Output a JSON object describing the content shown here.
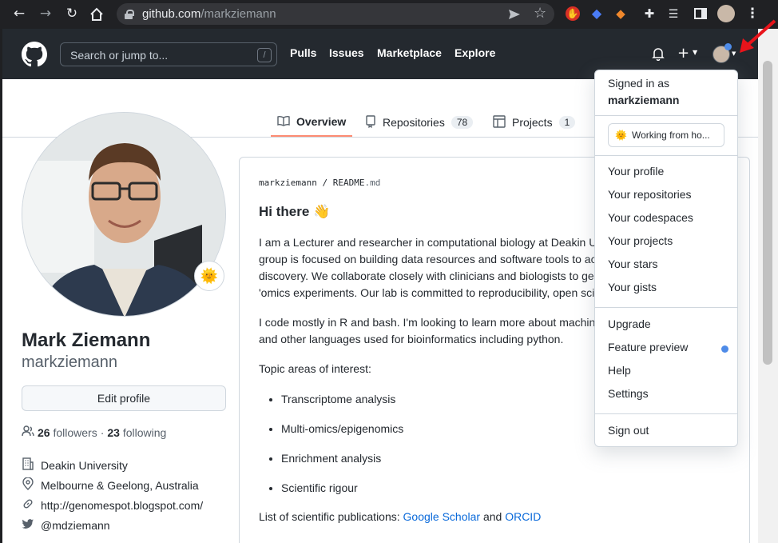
{
  "browser": {
    "url_host": "github.com",
    "url_path": "/markziemann"
  },
  "header": {
    "search_placeholder": "Search or jump to...",
    "search_shortcut": "/",
    "nav": [
      "Pulls",
      "Issues",
      "Marketplace",
      "Explore"
    ]
  },
  "tabs": [
    {
      "label": "Overview",
      "count": null
    },
    {
      "label": "Repositories",
      "count": "78"
    },
    {
      "label": "Projects",
      "count": "1"
    }
  ],
  "profile": {
    "name": "Mark Ziemann",
    "login": "markziemann",
    "edit_label": "Edit profile",
    "followers_count": "26",
    "followers_label": "followers",
    "separator": "·",
    "following_count": "23",
    "following_label": "following",
    "company": "Deakin University",
    "location": "Melbourne & Geelong, Australia",
    "website": "http://genomespot.blogspot.com/",
    "twitter": "@mdziemann",
    "status_emoji": "🌞"
  },
  "readme": {
    "path_user": "markziemann",
    "path_sep": "/",
    "path_file": "README",
    "path_ext": ".md",
    "heading": "Hi there 👋",
    "para1_lines": [
      "I am a Lecturer and researcher in computational biology at Deakin U",
      "group is focused on building data resources and software tools to ac",
      "discovery. We collaborate closely with clinicians and biologists to ge",
      "'omics experiments. Our lab is committed to reproducibility, open sci"
    ],
    "para2_lines": [
      "I code mostly in R and bash. I'm looking to learn more about machin",
      "and other languages used for bioinformatics including python."
    ],
    "topics_intro": "Topic areas of interest:",
    "topics": [
      "Transcriptome analysis",
      "Multi-omics/epigenomics",
      "Enrichment analysis",
      "Scientific rigour"
    ],
    "pubs_prefix": "List of scientific publications:",
    "pubs_link1": "Google Scholar",
    "pubs_and": "and",
    "pubs_link2": "ORCID"
  },
  "dropdown": {
    "signed_in_as": "Signed in as",
    "username": "markziemann",
    "status": "Working from ho...",
    "group1": [
      "Your profile",
      "Your repositories",
      "Your codespaces",
      "Your projects",
      "Your stars",
      "Your gists"
    ],
    "group2": [
      "Upgrade",
      "Feature preview",
      "Help",
      "Settings"
    ],
    "sign_out": "Sign out"
  },
  "colors": {
    "header_bg": "#24292f",
    "link": "#0969da",
    "tab_underline": "#fd8c73",
    "feature_dot": "#4e8be8",
    "arrow": "#e8141b"
  }
}
